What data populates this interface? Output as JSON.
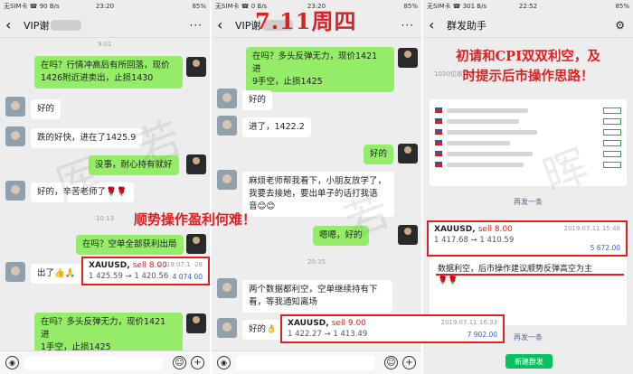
{
  "panels": [
    {
      "status_left": "无SIM卡 ☎ 90 B/s",
      "status_time": "23:20",
      "status_right": "85%",
      "title": "VIP谢",
      "time_1": "9:01",
      "msg_1_line1": "在吗？行情冲高后有所回落，现价",
      "msg_1_line2": "1426附近进卖出，止损1430",
      "msg_2": "好的",
      "msg_3": "跌的好快，进在了1425.9",
      "msg_4": "没事，耐心持有就好",
      "msg_5": "好的，辛苦老师了🌹🌹",
      "time_2": "10:13",
      "msg_6": "在吗？空单全部获利出局",
      "msg_7": "出了👍🙏",
      "trade_symbol": "XAUUSD",
      "trade_side": "sell 8.00",
      "trade_prices": "1 425.59 → 1 420.56",
      "trade_time": "2019.07.1",
      "trade_time_end": "28",
      "trade_pnl": "4 074 00",
      "msg_8_line1": "在吗？多头反弹无力，现价1421 进",
      "msg_8_line2": "1手空，止损1425"
    },
    {
      "status_left": "无SIM卡 ☎ 0 B/s",
      "status_time": "23:20",
      "status_right": "85%",
      "title": "VIP谢",
      "msg_1_line1": "在吗？多头反弹无力，现价1421 进",
      "msg_1_line2": "9手空，止损1425",
      "msg_2": "好的",
      "msg_3": "进了，1422.2",
      "msg_4": "好的",
      "msg_5_line1": "麻烦老师帮我看下，小朋友放学了，",
      "msg_5_line2": "我要去接她，要出单子的话打我语",
      "msg_5_line3": "音😊😊",
      "msg_6": "嗯嗯，好的",
      "time_1": "20:35",
      "msg_7_line1": "两个数据都利空，空单继续持有下",
      "msg_7_line2": "看，等我通知离场",
      "msg_8": "好的👌",
      "trade_symbol": "XAUUSD",
      "trade_side": "sell 9.00",
      "trade_prices": "1 422.27 → 1 413.49",
      "trade_time": "2019.07.11 16:33",
      "trade_pnl": "7 902.00"
    },
    {
      "status_left": "无SIM卡 ☎ 301 B/s",
      "status_time": "22:52",
      "status_right": "85%",
      "title": "群发助手",
      "recipients": "1030位收件人：",
      "again_1": "再发一条",
      "trade_symbol": "XAUUSD",
      "trade_side": "sell 8.00",
      "trade_prices": "1 417.68 → 1 410.59",
      "trade_time": "2019.07.11 15:48",
      "trade_pnl": "5 672.00",
      "msg_line1": "数据利空，后市操作建议顺势反弹高空为主",
      "msg_line2": "🌹🌹",
      "again_2": "再发一条",
      "send_button": "新建群发"
    }
  ],
  "overlays": {
    "header": "7.11周四",
    "right_note_line1": "初请和CPI双双利空，及",
    "right_note_line2": "时提示后市操作思路！",
    "mid_note": "顺势操作盈利何难！"
  },
  "colors": {
    "accent_red": "#e02020",
    "bubble_green": "#95ec69",
    "send_green": "#07c160"
  }
}
